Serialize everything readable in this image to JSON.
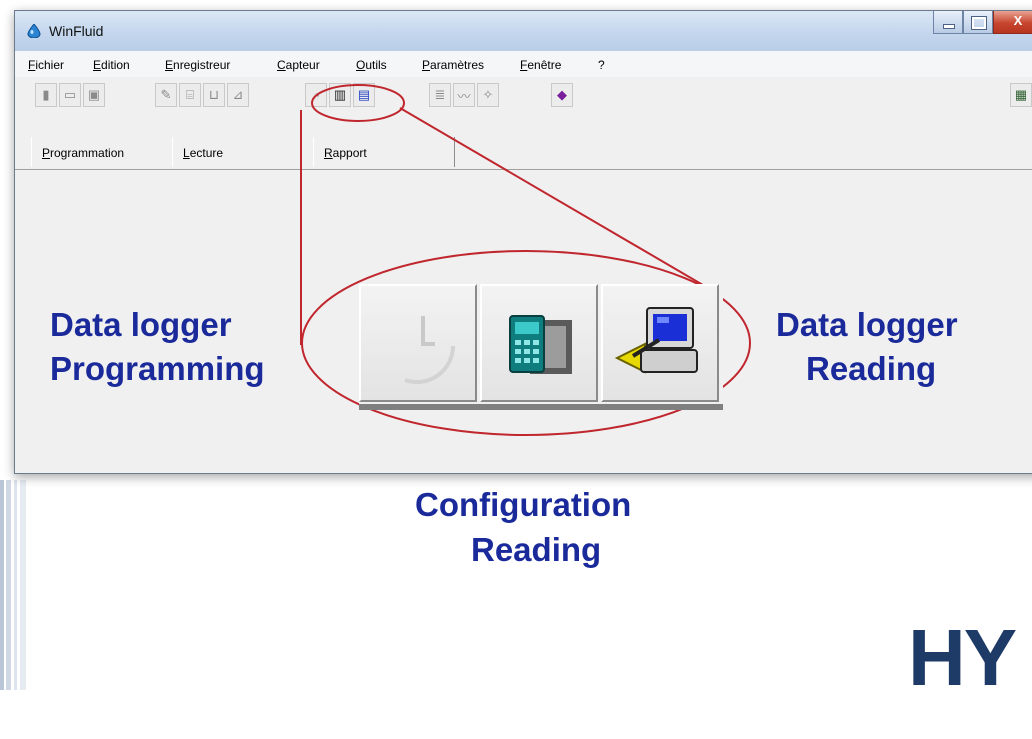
{
  "window": {
    "title": "WinFluid",
    "close_glyph": "X"
  },
  "menu": [
    "Fichier",
    "Edition",
    "Enregistreur",
    "Capteur",
    "Outils",
    "Paramètres",
    "Fenêtre",
    "?"
  ],
  "tabs": [
    "Programmation",
    "Lecture",
    "Rapport"
  ],
  "annotations": {
    "left_line1": "Data logger",
    "left_line2": "Programming",
    "right_line1": "Data logger",
    "right_line2": "Reading",
    "bottom_line1": "Configuration",
    "bottom_line2": "Reading"
  },
  "brand_partial": "HY",
  "colors": {
    "annotation_text": "#1a2a9a",
    "highlight": "#c0262d",
    "brand": "#1e3a67"
  }
}
